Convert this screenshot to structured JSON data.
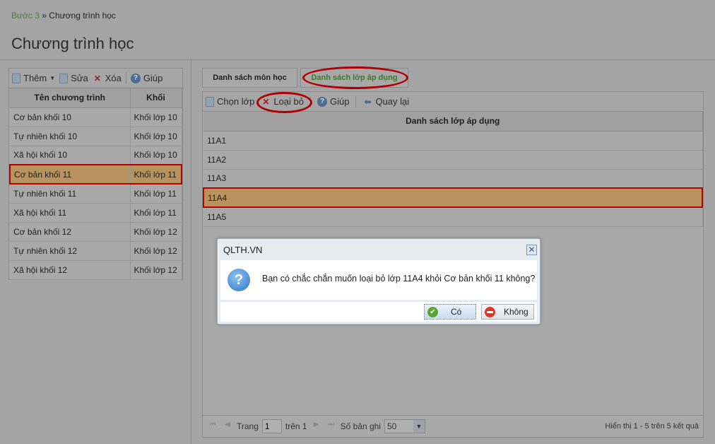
{
  "breadcrumb": {
    "step": "Bước 3",
    "sep": "»",
    "current": "Chương trình học"
  },
  "page_title": "Chương trình học",
  "left_toolbar": {
    "add": "Thêm",
    "edit": "Sửa",
    "delete": "Xóa",
    "help": "Giúp"
  },
  "left_table": {
    "headers": [
      "Tên chương trình",
      "Khối"
    ],
    "rows": [
      [
        "Cơ bản khối 10",
        "Khối lớp 10"
      ],
      [
        "Tự nhiên khối 10",
        "Khối lớp 10"
      ],
      [
        "Xã hội khối 10",
        "Khối lớp 10"
      ],
      [
        "Cơ bản khối 11",
        "Khối lớp 11"
      ],
      [
        "Tự nhiên khối 11",
        "Khối lớp 11"
      ],
      [
        "Xã hội khối 11",
        "Khối lớp 11"
      ],
      [
        "Cơ bản khối 12",
        "Khối lớp 12"
      ],
      [
        "Tự nhiên khối 12",
        "Khối lớp 12"
      ],
      [
        "Xã hội khối 12",
        "Khối lớp 12"
      ]
    ],
    "selected_index": 3
  },
  "tabs": [
    "Danh sách môn học",
    "Danh sách lớp áp dụng"
  ],
  "right_toolbar": {
    "choose": "Chọn lớp",
    "remove": "Loại bỏ",
    "help": "Giúp",
    "back": "Quay lại"
  },
  "right_table": {
    "header": "Danh sách lớp áp dụng",
    "rows": [
      "11A1",
      "11A2",
      "11A3",
      "11A4",
      "11A5"
    ],
    "selected_index": 3
  },
  "pager": {
    "page_label": "Trang",
    "page": "1",
    "of": "trên 1",
    "size_label": "Số bản ghi",
    "size": "50",
    "summary": "Hiển thị 1 - 5 trên 5 kết quả"
  },
  "dialog": {
    "title": "QLTH.VN",
    "message": "Bạn có chắc chắn muốn loại bỏ lớp 11A4 khỏi Cơ bản khối 11 không?",
    "yes": "Có",
    "no": "Không"
  }
}
